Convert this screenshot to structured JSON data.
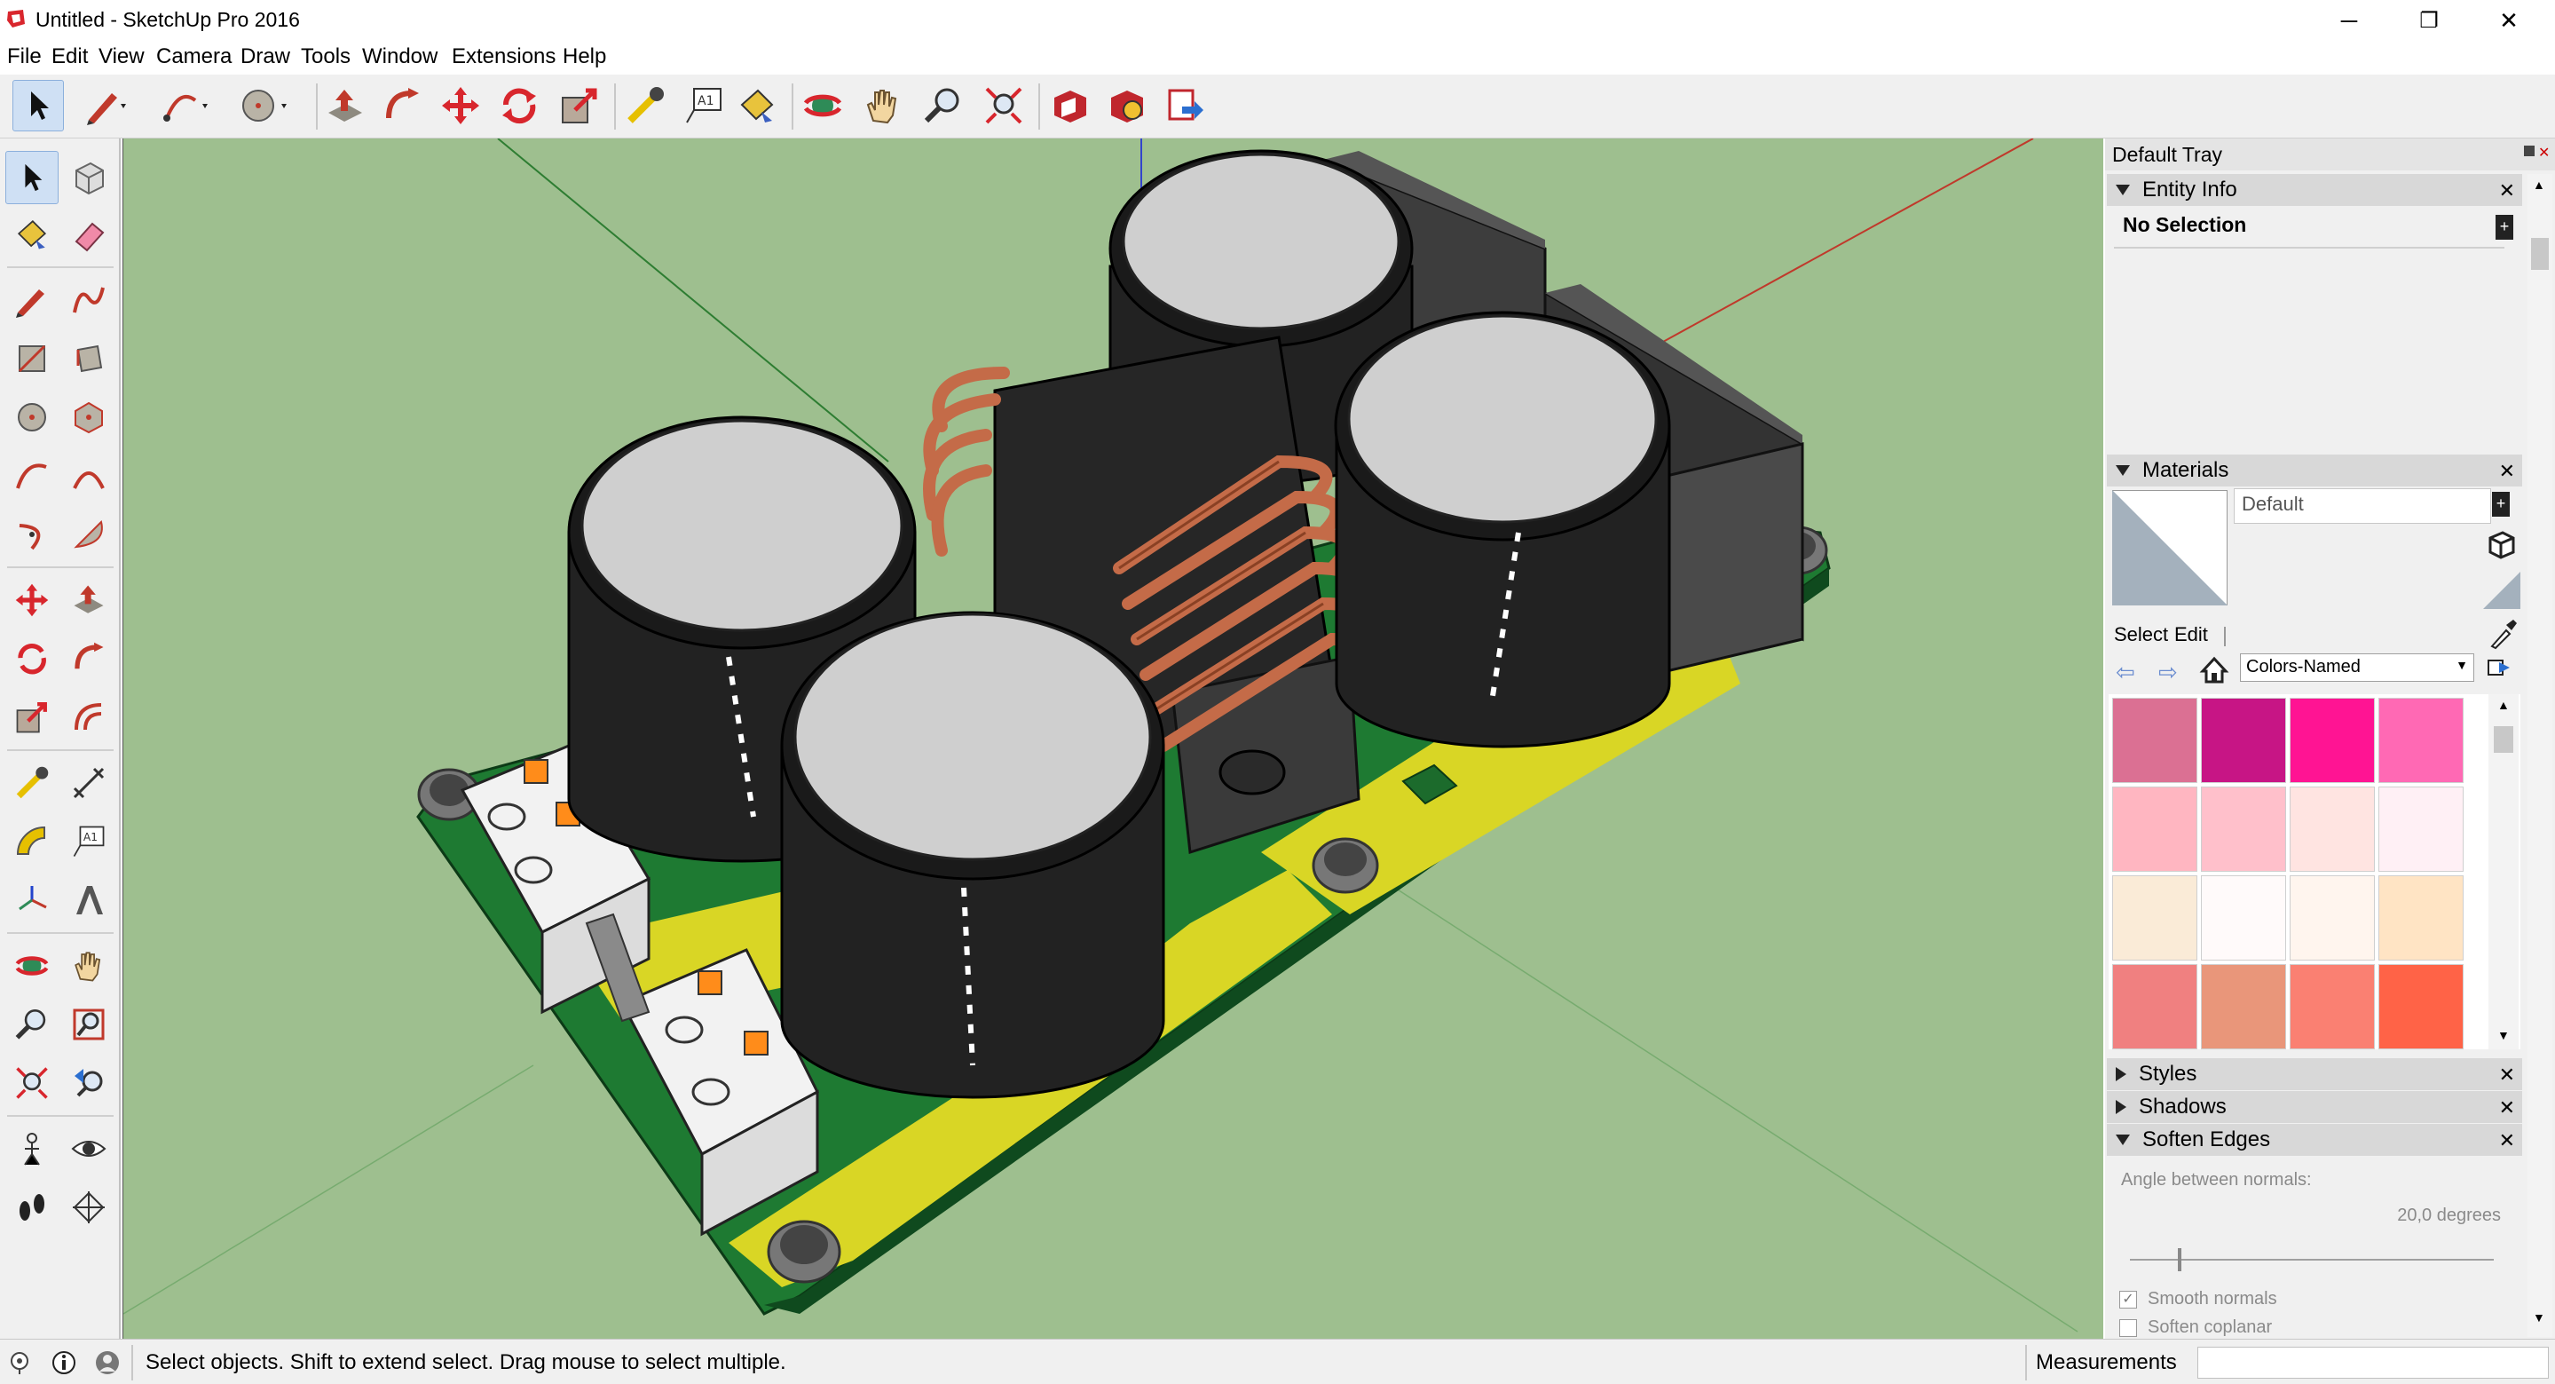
{
  "window": {
    "title": "Untitled - SketchUp Pro 2016",
    "minimize_label": "─",
    "restore_label": "❐",
    "close_label": "✕"
  },
  "menu": {
    "items": [
      "File",
      "Edit",
      "View",
      "Camera",
      "Draw",
      "Tools",
      "Window",
      "Extensions",
      "Help"
    ]
  },
  "toolbar": {
    "icons": [
      "select-icon",
      "pencil-line-icon",
      "arc-icon",
      "circle-icon",
      "push-pull-icon",
      "follow-me-icon",
      "move-icon",
      "rotate-icon",
      "scale-icon",
      "tape-measure-icon",
      "text-label-icon",
      "paint-bucket-icon",
      "orbit-icon",
      "pan-icon",
      "zoom-icon",
      "zoom-extents-icon",
      "warehouse-icon",
      "extension-warehouse-icon",
      "send-to-layout-icon"
    ]
  },
  "tray": {
    "title": "Default Tray",
    "entity_info": {
      "header": "Entity Info",
      "value": "No Selection"
    },
    "materials": {
      "header": "Materials",
      "material_name": "Default",
      "tab_select": "Select",
      "tab_edit": "Edit",
      "library": "Colors-Named",
      "swatch_colors": [
        "#db7093",
        "#c71585",
        "#ff1493",
        "#ff69b4",
        "#ffb6c1",
        "#ffc0cb",
        "#ffe4e1",
        "#fff0f5",
        "#faebd7",
        "#fffafa",
        "#fff5ee",
        "#ffe4c4",
        "#f08080",
        "#e9967a",
        "#fa8072",
        "#ff6347"
      ]
    },
    "styles": {
      "header": "Styles"
    },
    "shadows": {
      "header": "Shadows"
    },
    "soften_edges": {
      "header": "Soften Edges",
      "angle_label": "Angle between normals:",
      "angle_value": "20,0  degrees",
      "smooth_normals": "Smooth normals",
      "soften_coplanar": "Soften coplanar",
      "smooth_checked": true,
      "coplanar_checked": false
    }
  },
  "status": {
    "hint": "Select objects. Shift to extend select. Drag mouse to select multiple.",
    "measurements_label": "Measurements"
  }
}
